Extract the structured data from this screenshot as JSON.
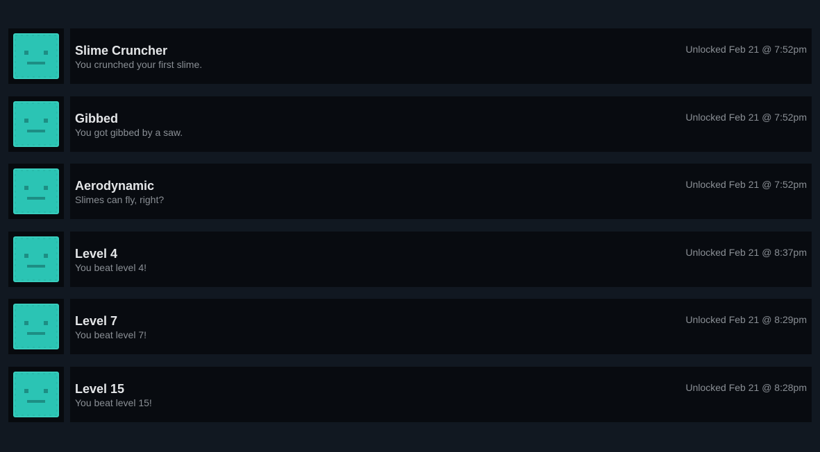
{
  "achievement_icon": {
    "name": "slime-face-icon",
    "color": "#2bc4b4"
  },
  "achievements": [
    {
      "title": "Slime Cruncher",
      "description": "You crunched your first slime.",
      "unlocked": "Unlocked Feb 21 @ 7:52pm"
    },
    {
      "title": "Gibbed",
      "description": "You got gibbed by a saw.",
      "unlocked": "Unlocked Feb 21 @ 7:52pm"
    },
    {
      "title": "Aerodynamic",
      "description": "Slimes can fly, right?",
      "unlocked": "Unlocked Feb 21 @ 7:52pm"
    },
    {
      "title": "Level 4",
      "description": "You beat level 4!",
      "unlocked": "Unlocked Feb 21 @ 8:37pm"
    },
    {
      "title": "Level 7",
      "description": "You beat level 7!",
      "unlocked": "Unlocked Feb 21 @ 8:29pm"
    },
    {
      "title": "Level 15",
      "description": "You beat level 15!",
      "unlocked": "Unlocked Feb 21 @ 8:28pm"
    }
  ]
}
